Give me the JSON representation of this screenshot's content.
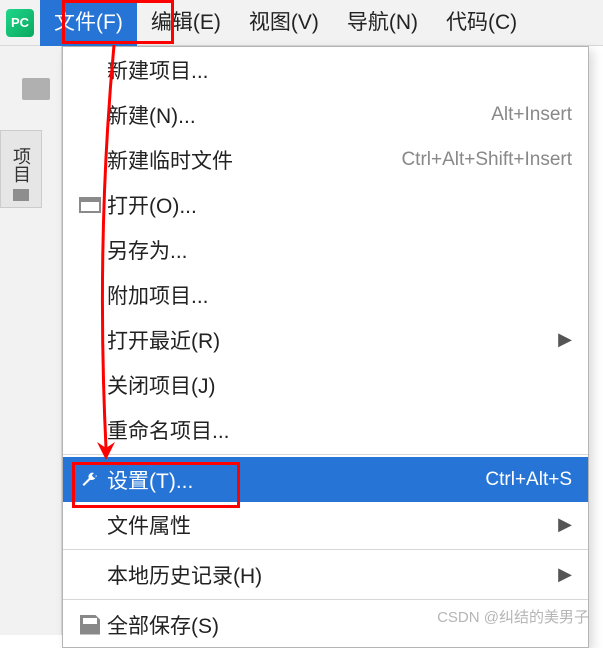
{
  "app_icon_text": "PC",
  "menubar": {
    "file": "文件(F)",
    "edit": "编辑(E)",
    "view": "视图(V)",
    "navigate": "导航(N)",
    "code": "代码(C)"
  },
  "sidebar": {
    "project_tab": "项目"
  },
  "dropdown": {
    "new_project": "新建项目...",
    "new": "新建(N)...",
    "new_shortcut": "Alt+Insert",
    "new_scratch": "新建临时文件",
    "new_scratch_shortcut": "Ctrl+Alt+Shift+Insert",
    "open": "打开(O)...",
    "save_as": "另存为...",
    "attach_project": "附加项目...",
    "open_recent": "打开最近(R)",
    "close_project": "关闭项目(J)",
    "rename_project": "重命名项目...",
    "settings": "设置(T)...",
    "settings_shortcut": "Ctrl+Alt+S",
    "file_properties": "文件属性",
    "local_history": "本地历史记录(H)",
    "save_all": "全部保存(S)"
  },
  "watermark": "CSDN @纠结的美男子"
}
